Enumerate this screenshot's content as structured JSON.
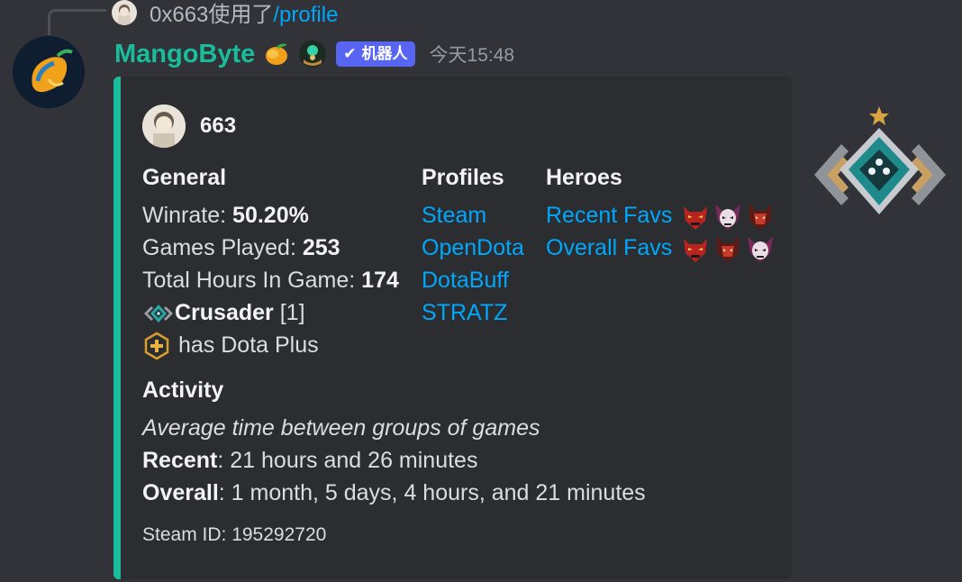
{
  "reply": {
    "user": "0x663",
    "used_text": "使用了",
    "command": "/profile"
  },
  "message": {
    "username": "MangoByte",
    "bot_tag": "机器人",
    "timestamp": "今天15:48"
  },
  "embed": {
    "author": "663",
    "accent_color": "#1abc9c",
    "general": {
      "title": "General",
      "winrate_label": "Winrate:",
      "winrate_value": "50.20%",
      "games_label": "Games Played:",
      "games_value": "253",
      "hours_label": "Total Hours In Game:",
      "hours_value": "174",
      "rank_name": "Crusader",
      "rank_stars": "[1]",
      "dota_plus": "has Dota Plus"
    },
    "profiles": {
      "title": "Profiles",
      "links": [
        "Steam",
        "OpenDota",
        "DotaBuff",
        "STRATZ"
      ]
    },
    "heroes": {
      "title": "Heroes",
      "recent_label": "Recent Favs",
      "overall_label": "Overall Favs"
    },
    "activity": {
      "title": "Activity",
      "subtitle": "Average time between groups of games",
      "recent_label": "Recent",
      "recent_value": ": 21 hours and 26 minutes",
      "overall_label": "Overall",
      "overall_value": ": 1 month, 5 days, 4 hours, and 21 minutes"
    },
    "footer": "Steam ID: 195292720"
  }
}
